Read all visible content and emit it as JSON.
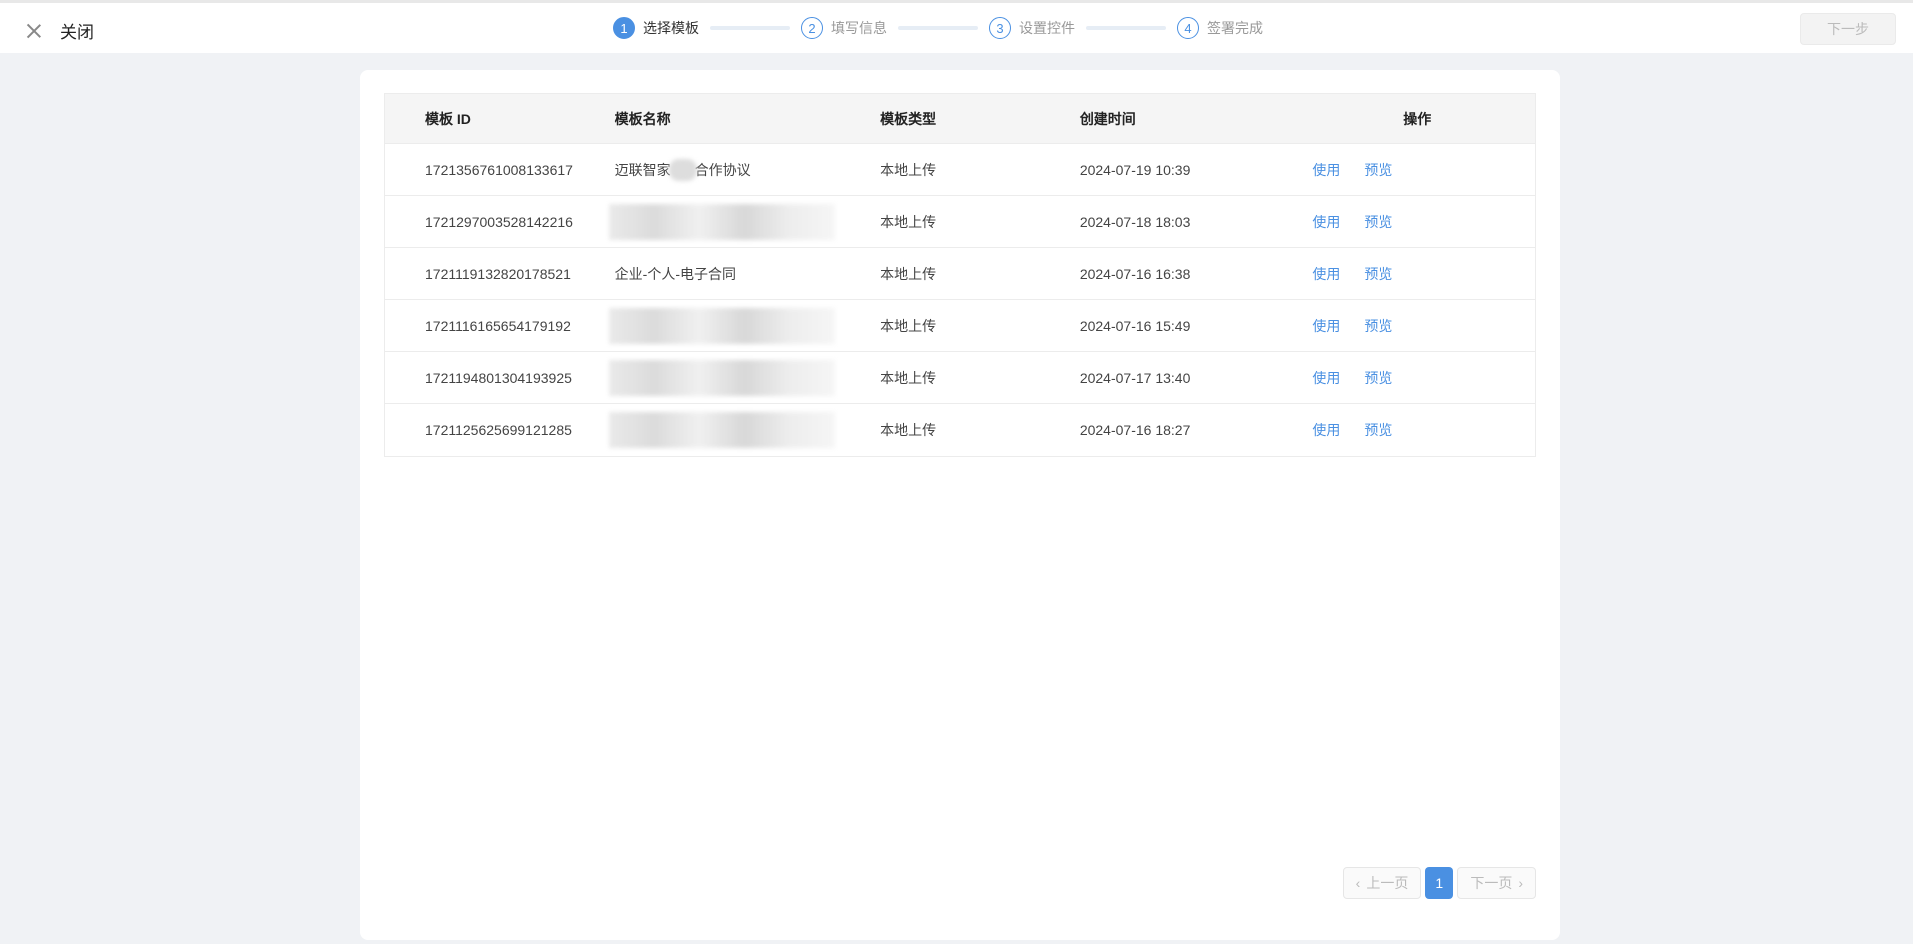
{
  "header": {
    "close_label": "关闭",
    "next_label": "下一步",
    "steps": [
      {
        "num": "1",
        "label": "选择模板"
      },
      {
        "num": "2",
        "label": "填写信息"
      },
      {
        "num": "3",
        "label": "设置控件"
      },
      {
        "num": "4",
        "label": "签署完成"
      }
    ]
  },
  "table": {
    "headers": {
      "id": "模板 ID",
      "name": "模板名称",
      "type": "模板类型",
      "time": "创建时间",
      "ops": "操作"
    },
    "rows": [
      {
        "id": "1721356761008133617",
        "name_prefix": "迈联智家",
        "name_suffix": "合作协议",
        "type": "本地上传",
        "time": "2024-07-19 10:39",
        "use": "使用",
        "preview": "预览"
      },
      {
        "id": "1721297003528142216",
        "name": "",
        "type": "本地上传",
        "time": "2024-07-18 18:03",
        "use": "使用",
        "preview": "预览"
      },
      {
        "id": "1721119132820178521",
        "name": "企业-个人-电子合同",
        "type": "本地上传",
        "time": "2024-07-16 16:38",
        "use": "使用",
        "preview": "预览"
      },
      {
        "id": "1721116165654179192",
        "name": "",
        "type": "本地上传",
        "time": "2024-07-16 15:49",
        "use": "使用",
        "preview": "预览"
      },
      {
        "id": "1721194801304193925",
        "name": "",
        "type": "本地上传",
        "time": "2024-07-17 13:40",
        "use": "使用",
        "preview": "预览"
      },
      {
        "id": "1721125625699121285",
        "name": "",
        "type": "本地上传",
        "time": "2024-07-16 18:27",
        "use": "使用",
        "preview": "预览"
      }
    ]
  },
  "pagination": {
    "prev": "上一页",
    "current": "1",
    "next": "下一页"
  }
}
